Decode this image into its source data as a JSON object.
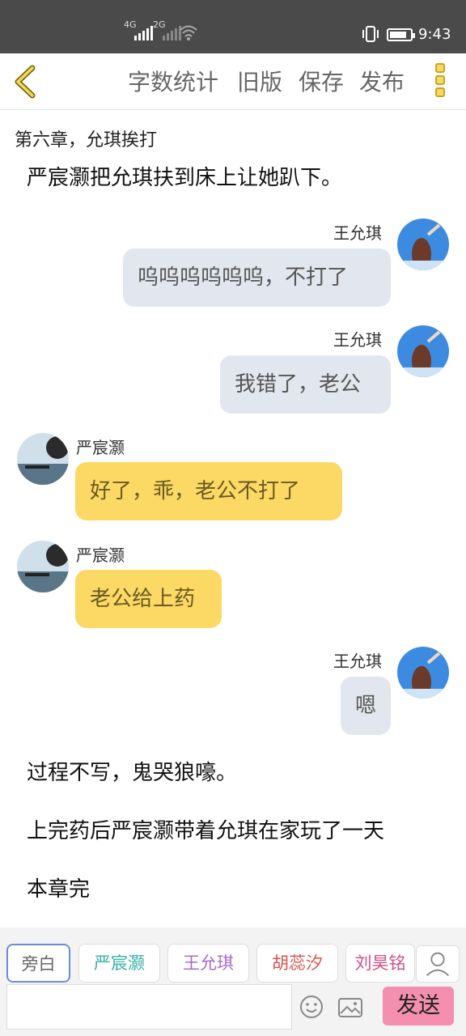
{
  "status": {
    "sig1": "4G",
    "sig2": "2G",
    "time": "9:43",
    "battery_level": 0.85
  },
  "toolbar": {
    "word_count": "字数统计",
    "old_version": "旧版",
    "save": "保存",
    "publish": "发布"
  },
  "chapter": {
    "title": "第六章，允琪挨打"
  },
  "content": {
    "narration_1": "严宸灏把允琪扶到床上让她趴下。",
    "messages": [
      {
        "speaker": "王允琪",
        "text": "呜呜呜呜呜呜，不打了"
      },
      {
        "speaker": "王允琪",
        "text": "我错了，老公"
      },
      {
        "speaker": "严宸灏",
        "text": "好了，乖，老公不打了"
      },
      {
        "speaker": "严宸灏",
        "text": "老公给上药"
      },
      {
        "speaker": "王允琪",
        "text": "嗯"
      }
    ],
    "narration_2": "过程不写，鬼哭狼嚎。",
    "narration_3": "上完药后严宸灏带着允琪在家玩了一天",
    "narration_4": "本章完"
  },
  "characters": [
    {
      "name": "旁白",
      "color": "#666666"
    },
    {
      "name": "严宸灏",
      "color": "#36b0a6"
    },
    {
      "name": "王允琪",
      "color": "#a86ad0"
    },
    {
      "name": "胡蕊汐",
      "color": "#d9534f"
    },
    {
      "name": "刘昊铭",
      "color": "#d04f8c"
    }
  ],
  "composer": {
    "input_value": "",
    "send": "发送"
  },
  "colors": {
    "accent_yellow": "#fcd965",
    "right_bubble": "#e2e6ee",
    "send_pink": "#f58fb0"
  }
}
